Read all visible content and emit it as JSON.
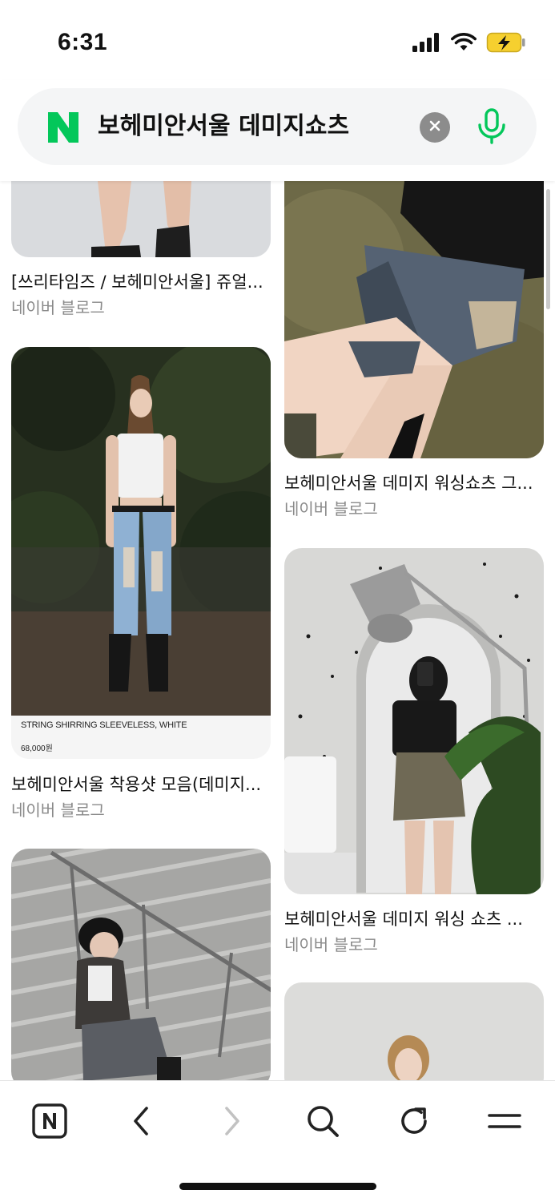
{
  "status_bar": {
    "time": "6:31",
    "icons": [
      "signal-icon",
      "wifi-icon",
      "battery-charging-icon"
    ]
  },
  "search": {
    "brand": "N",
    "query": "보헤미안서울 데미지쇼츠",
    "icons": [
      "naver-logo-icon",
      "clear-icon",
      "microphone-icon"
    ],
    "accent_color": "#03c75a"
  },
  "feed": {
    "left_column": [
      {
        "title": "[쓰리타임즈 / 보헤미안서울] 쥬얼...",
        "source": "네이버 블로그"
      },
      {
        "title": "보헤미안서울 착용샷 모음(데미지...",
        "source": "네이버 블로그",
        "image_caption": "STRING SHIRRING SLEEVELESS, WHITE",
        "image_price": "68,000원"
      },
      {
        "title": "",
        "source": ""
      }
    ],
    "right_column": [
      {
        "title": "보헤미안서울 데미지 워싱쇼츠 그...",
        "source": "네이버 블로그"
      },
      {
        "title": "보헤미안서울 데미지 워싱 쇼츠 ...",
        "source": "네이버 블로그"
      },
      {
        "title": "",
        "source": ""
      }
    ]
  },
  "toolbar": {
    "items": [
      "naver-home-icon",
      "back-icon",
      "forward-icon",
      "search-icon",
      "refresh-icon",
      "menu-icon"
    ]
  }
}
